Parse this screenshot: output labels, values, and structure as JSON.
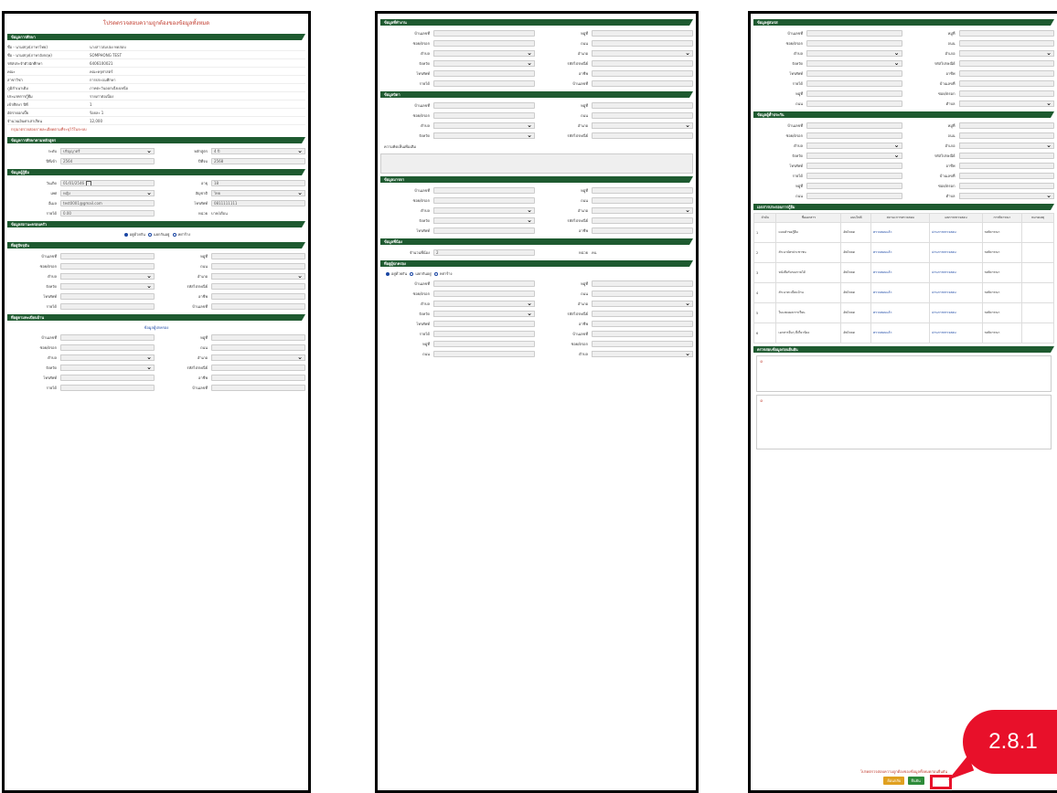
{
  "panel1": {
    "title": "โปรดตรวจสอบความถูกต้องของข้อมูลทั้งหมด",
    "sections": [
      {
        "header": "ข้อมูลการศึกษา",
        "rows": [
          [
            "ชื่อ - นามสกุล(ภาษาไทย)",
            "นางสาวสมปอง ทดสอบ"
          ],
          [
            "ชื่อ - นามสกุล(ภาษาอังกฤษ)",
            "SOMPHONG TEST"
          ],
          [
            "รหัสประจำตัวนักศึกษา",
            "6406100021"
          ],
          [
            "คณะ",
            "คณะครุศาสตร์"
          ],
          [
            "สาขาวิชา",
            "การประถมศึกษา"
          ],
          [
            "ภูมิลำเนาเดิม",
            "ภาคตะวันออกเฉียงเหนือ"
          ],
          [
            "ประเภทการกู้ยืม",
            "รายเก่าต่อเนื่อง"
          ],
          [
            "เข้าศึกษา ปีที่",
            "1"
          ],
          [
            "อัตราดอกเบี้ย",
            "ร้อยละ 1"
          ],
          [
            "จำนวนเงินค่าเล่าเรียน",
            "12,000"
          ]
        ]
      },
      {
        "header": "ข้อมูลการศึกษาตามหลักสูตร"
      },
      {
        "header": "ข้อมูลผู้กู้ยืม"
      },
      {
        "header": "ข้อมูลสถานะครอบครัว"
      },
      {
        "header": "ที่อยู่ปัจจุบัน"
      },
      {
        "header": "ที่อยู่ตามทะเบียนบ้าน"
      }
    ],
    "note_red": "กรุณาตรวจสอบรายละเอียดตามที่ระบุไว้ในระบบ",
    "parents_label": "ข้อมูลผู้ปกครอง",
    "email": "test0001@gmail.com",
    "phone": "0811111111",
    "income": "0.00",
    "income_unit": "บาท/เดือน"
  },
  "panel2": {
    "sections": [
      "ข้อมูลที่ทำงาน",
      "ข้อมูลบิดา",
      "ข้อมูลมารดา",
      "ข้อมูลพี่น้อง",
      "ที่อยู่ผู้ปกครอง"
    ],
    "radio_opts": [
      "อยู่ด้วยกัน",
      "แยกกันอยู่",
      "หย่าร้าง"
    ],
    "address_labels": [
      "บ้านเลขที่",
      "หมู่ที่",
      "ซอย/ตรอก",
      "ถนน",
      "ตำบล",
      "อำเภอ",
      "จังหวัด",
      "รหัสไปรษณีย์",
      "โทรศัพท์",
      "อาชีพ",
      "รายได้"
    ],
    "income_unit": "บาท/เดือน",
    "comment_label": "ความคิดเห็นเพิ่มเติม",
    "siblings_count": "2",
    "siblings_unit": "คน"
  },
  "panel3": {
    "sections": [
      "ข้อมูลคู่สมรส",
      "ข้อมูลผู้ค้ำประกัน",
      "เอกสารประกอบการกู้ยืม",
      "ตรวจสอบข้อมูลก่อนยืนยัน"
    ],
    "table_headers": [
      "ลำดับ",
      "ชื่อเอกสาร",
      "แนบไฟล์",
      "สถานะการตรวจสอบ",
      "ผลการตรวจสอบ",
      "การพิจารณา",
      "หมายเหตุ"
    ],
    "docs": [
      "แบบคำขอกู้ยืม",
      "สำเนาบัตรประชาชน",
      "หนังสือรับรองรายได้",
      "สำเนาทะเบียนบ้าน",
      "ใบแสดงผลการเรียน",
      "เอกสารอื่นๆ ที่เกี่ยวข้อง"
    ],
    "upload_label": "อัพโหลด",
    "status_label": "ตรวจสอบแล้ว",
    "result_label": "ผ่านการตรวจสอบ",
    "consider_label": "รอพิจารณา",
    "footer_text": "โปรดตรวจสอบความถูกต้องของข้อมูลทั้งหมดก่อนยืนยัน",
    "btn_back": "ย้อนกลับ",
    "btn_confirm": "ยืนยัน"
  },
  "callout": {
    "label": "2.8.1"
  },
  "colors": {
    "section": "#1e5a30",
    "accent": "#e8102a"
  }
}
